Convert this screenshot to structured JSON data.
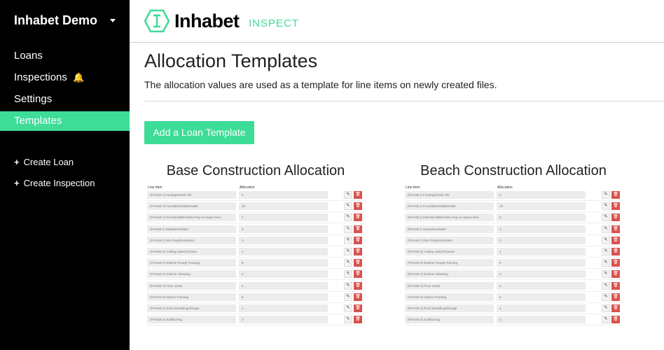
{
  "sidebar": {
    "brand": "Inhabet Demo",
    "items": [
      {
        "label": "Loans"
      },
      {
        "label": "Inspections"
      },
      {
        "label": "Settings"
      },
      {
        "label": "Templates"
      }
    ],
    "bell": "🔔",
    "actions": [
      {
        "label": "Create Loan"
      },
      {
        "label": "Create Inspection"
      }
    ],
    "plus": "+"
  },
  "header": {
    "logo_word": "Inhabet",
    "logo_sub": "INSPECT"
  },
  "main": {
    "title": "Allocation Templates",
    "description": "The allocation values are used as a template for line items on newly created files.",
    "add_button": "Add a Loan Template"
  },
  "colors": {
    "accent": "#3ddc97",
    "danger": "#d9534f",
    "sidebar_bg": "#000000"
  },
  "templates": [
    {
      "title": "Base Construction Allocation",
      "col_line_item": "Line Item",
      "col_allocation": "Allocation",
      "rows": [
        {
          "name": "(PHASE I) Footings/Drain Tile",
          "value": "2"
        },
        {
          "name": "(PHASE I) Foundation/Slab/Grade",
          "value": "10"
        },
        {
          "name": "(PHASE I) Permits/Utilities/Site Prep & Impact fees",
          "value": "2"
        },
        {
          "name": "(PHASE I) Sanitation/Water",
          "value": "3"
        },
        {
          "name": "(PHASE I) Site Prep/Excavation",
          "value": "3"
        },
        {
          "name": "(PHASE II) Ceiling Joists/Trusses",
          "value": "4"
        },
        {
          "name": "(PHASE II) Exterior Rough Framing",
          "value": "5"
        },
        {
          "name": "(PHASE II) Exterior Sheeting",
          "value": "2"
        },
        {
          "name": "(PHASE II) Floor Joists",
          "value": "4"
        },
        {
          "name": "(PHASE II) Interior Framing",
          "value": "5"
        },
        {
          "name": "(PHASE II) Roof Sheathing/Shingle",
          "value": "4"
        },
        {
          "name": "(PHASE II) Subflooring",
          "value": "2"
        }
      ]
    },
    {
      "title": "Beach Construction Allocation",
      "col_line_item": "Line Item",
      "col_allocation": "Allocation",
      "rows": [
        {
          "name": "(PHASE I) Footings/Drain Tile",
          "value": "2"
        },
        {
          "name": "(PHASE I) Foundation/Slab/Grade",
          "value": "10"
        },
        {
          "name": "(PHASE I) Permits/Utilities/Site Prep & Impact fees",
          "value": "2"
        },
        {
          "name": "(PHASE I) Sanitation/Water",
          "value": "3"
        },
        {
          "name": "(PHASE I) Site Prep/Excavation",
          "value": "3"
        },
        {
          "name": "(PHASE II) Ceiling Joists/Trusses",
          "value": "4"
        },
        {
          "name": "(PHASE II) Exterior Rough Framing",
          "value": "5"
        },
        {
          "name": "(PHASE II) Exterior Sheeting",
          "value": "2"
        },
        {
          "name": "(PHASE II) Floor Joists",
          "value": "4"
        },
        {
          "name": "(PHASE II) Interior Framing",
          "value": "5"
        },
        {
          "name": "(PHASE II) Roof Sheathing/Shingle",
          "value": "4"
        },
        {
          "name": "(PHASE II) Subflooring",
          "value": "2"
        }
      ]
    }
  ],
  "icons": {
    "edit": "✎",
    "delete": "🗑"
  }
}
